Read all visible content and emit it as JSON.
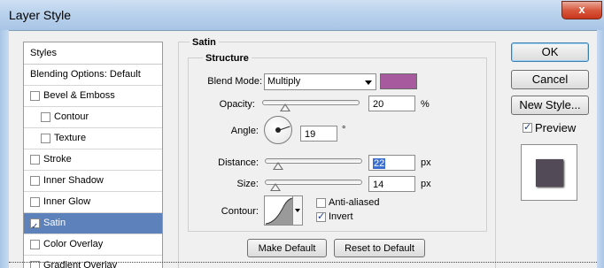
{
  "window": {
    "title": "Layer Style",
    "close_label": "x"
  },
  "styles_panel": {
    "header": "Styles",
    "items": [
      {
        "label": "Blending Options: Default",
        "has_checkbox": false,
        "checked": false,
        "indent": false,
        "selected": false
      },
      {
        "label": "Bevel & Emboss",
        "has_checkbox": true,
        "checked": false,
        "indent": false,
        "selected": false
      },
      {
        "label": "Contour",
        "has_checkbox": true,
        "checked": false,
        "indent": true,
        "selected": false
      },
      {
        "label": "Texture",
        "has_checkbox": true,
        "checked": false,
        "indent": true,
        "selected": false
      },
      {
        "label": "Stroke",
        "has_checkbox": true,
        "checked": false,
        "indent": false,
        "selected": false
      },
      {
        "label": "Inner Shadow",
        "has_checkbox": true,
        "checked": false,
        "indent": false,
        "selected": false
      },
      {
        "label": "Inner Glow",
        "has_checkbox": true,
        "checked": false,
        "indent": false,
        "selected": false
      },
      {
        "label": "Satin",
        "has_checkbox": true,
        "checked": true,
        "indent": false,
        "selected": true
      },
      {
        "label": "Color Overlay",
        "has_checkbox": true,
        "checked": false,
        "indent": false,
        "selected": false
      },
      {
        "label": "Gradient Overlay",
        "has_checkbox": true,
        "checked": false,
        "indent": false,
        "selected": false
      }
    ]
  },
  "satin": {
    "group_title": "Satin",
    "structure_title": "Structure",
    "blend_mode_label": "Blend Mode:",
    "blend_mode_value": "Multiply",
    "blend_color": "#a75a9d",
    "opacity_label": "Opacity:",
    "opacity_value": "20",
    "opacity_unit": "%",
    "opacity_level": 0.2,
    "angle_label": "Angle:",
    "angle_value": "19",
    "angle_unit": "°",
    "distance_label": "Distance:",
    "distance_value": "22",
    "distance_unit": "px",
    "distance_level": 0.09,
    "size_label": "Size:",
    "size_value": "14",
    "size_unit": "px",
    "size_level": 0.06,
    "contour_label": "Contour:",
    "anti_aliased_label": "Anti-aliased",
    "anti_aliased_checked": false,
    "invert_label": "Invert",
    "invert_checked": true,
    "make_default_label": "Make Default",
    "reset_default_label": "Reset to Default"
  },
  "right_panel": {
    "ok_label": "OK",
    "cancel_label": "Cancel",
    "new_style_label": "New Style...",
    "preview_label": "Preview",
    "preview_checked": true,
    "preview_color": "#524a56"
  }
}
